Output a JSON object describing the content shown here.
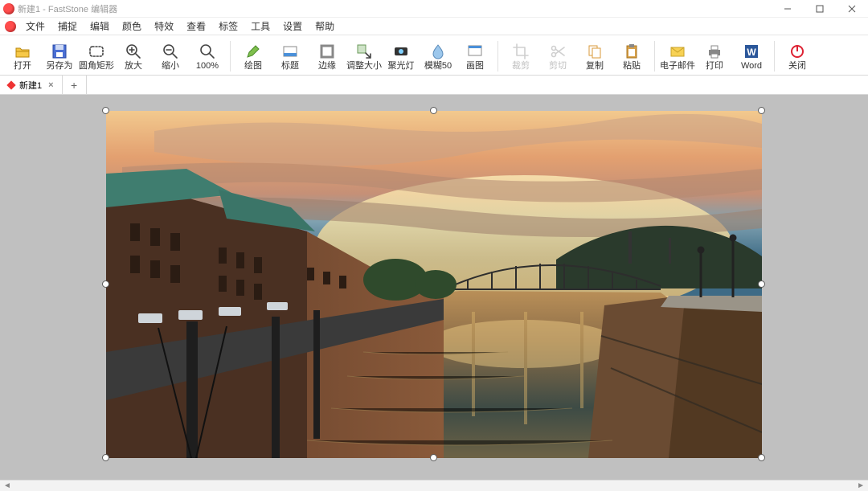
{
  "title": "新建1 - FastStone 编辑器",
  "window_controls": {
    "min": "min",
    "max": "max",
    "close": "close"
  },
  "menu": [
    "文件",
    "捕捉",
    "编辑",
    "颜色",
    "特效",
    "查看",
    "标签",
    "工具",
    "设置",
    "帮助"
  ],
  "toolbar_groups": [
    [
      {
        "id": "open",
        "label": "打开",
        "icon": "folder"
      },
      {
        "id": "saveas",
        "label": "另存为",
        "icon": "floppy"
      },
      {
        "id": "roundrect",
        "label": "圆角矩形",
        "icon": "roundrect"
      },
      {
        "id": "zoomin",
        "label": "放大",
        "icon": "zoom-in"
      },
      {
        "id": "zoomout",
        "label": "缩小",
        "icon": "zoom-out"
      },
      {
        "id": "zoom100",
        "label": "100%",
        "icon": "zoom-100"
      }
    ],
    [
      {
        "id": "draw",
        "label": "绘图",
        "icon": "pencil"
      },
      {
        "id": "caption",
        "label": "标题",
        "icon": "caption"
      },
      {
        "id": "edge",
        "label": "边缘",
        "icon": "edge"
      },
      {
        "id": "resize",
        "label": "调整大小",
        "icon": "resize"
      },
      {
        "id": "spotlight",
        "label": "聚光灯",
        "icon": "spotlight"
      },
      {
        "id": "blur50",
        "label": "模糊50",
        "icon": "blur"
      },
      {
        "id": "screenshot",
        "label": "画图",
        "icon": "frame"
      }
    ],
    [
      {
        "id": "crop",
        "label": "裁剪",
        "icon": "crop",
        "disabled": true
      },
      {
        "id": "cut",
        "label": "剪切",
        "icon": "scissors",
        "disabled": true
      },
      {
        "id": "copy",
        "label": "复制",
        "icon": "copies"
      },
      {
        "id": "paste",
        "label": "粘贴",
        "icon": "clipboard"
      }
    ],
    [
      {
        "id": "email",
        "label": "电子邮件",
        "icon": "envelope"
      },
      {
        "id": "print",
        "label": "打印",
        "icon": "printer"
      },
      {
        "id": "word",
        "label": "Word",
        "icon": "word"
      }
    ],
    [
      {
        "id": "close",
        "label": "关闭",
        "icon": "power"
      }
    ]
  ],
  "tabs": {
    "active": "新建1",
    "add": "+"
  },
  "image_alt": "城市运河日落景观"
}
